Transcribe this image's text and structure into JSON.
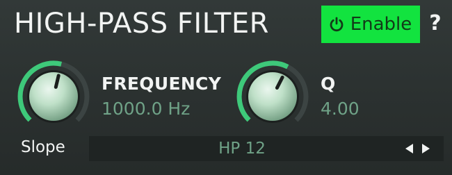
{
  "header": {
    "title": "HIGH-PASS FILTER",
    "enable_label": "Enable",
    "help_label": "?"
  },
  "frequency": {
    "name": "FREQUENCY",
    "value": "1000.0 Hz",
    "level": 0.55
  },
  "q": {
    "name": "Q",
    "value": "4.00",
    "level": 0.6
  },
  "slope": {
    "label": "Slope",
    "value": "HP 12"
  },
  "colors": {
    "background": "#2c3231",
    "enable_green": "#12e33f",
    "value_green": "#6fa287",
    "knob_arc": "#3ec97a"
  },
  "icons": {
    "power": "power-icon",
    "prev": "arrow-left-icon",
    "next": "arrow-right-icon"
  }
}
